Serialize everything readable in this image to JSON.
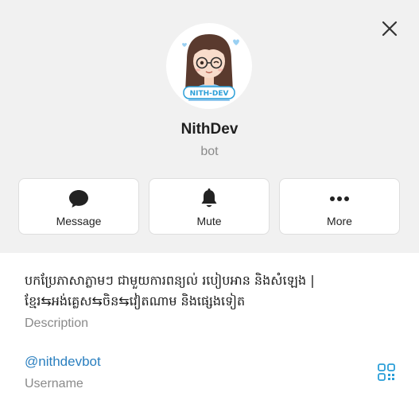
{
  "profile": {
    "name": "NithDev",
    "type": "bot",
    "avatar_badge": "NITH-DEV"
  },
  "actions": [
    {
      "label": "Message",
      "icon": "chat-bubble-icon"
    },
    {
      "label": "Mute",
      "icon": "bell-icon"
    },
    {
      "label": "More",
      "icon": "more-dots-icon"
    }
  ],
  "info": {
    "bio_line1": "បកប្រែភាសាភ្លាមៗ ជាមួយការពន្យល់ របៀបអាន និងសំឡេង |",
    "bio_line2": "ខ្មែរ⇆អង់គ្លេស⇆ចិន⇆វៀតណាម និងផ្សេងទៀត",
    "bio_label": "Description",
    "username": "@nithdevbot",
    "username_label": "Username"
  },
  "colors": {
    "header_bg": "#f1f1f1",
    "link": "#2a7fbf",
    "accent": "#2a9fd8"
  }
}
